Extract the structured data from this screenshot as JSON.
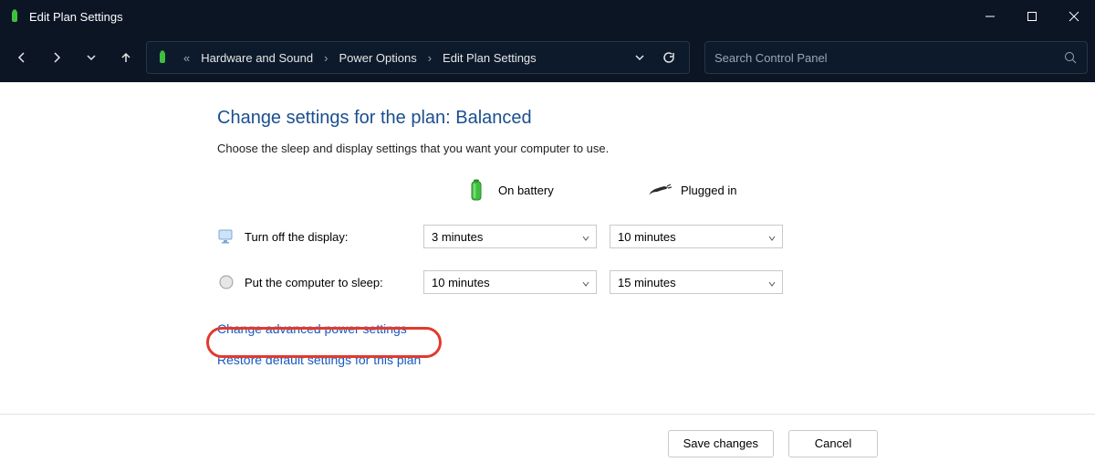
{
  "window": {
    "title": "Edit Plan Settings"
  },
  "breadcrumbs": {
    "item0": "Hardware and Sound",
    "item1": "Power Options",
    "item2": "Edit Plan Settings"
  },
  "search": {
    "placeholder": "Search Control Panel"
  },
  "page": {
    "title": "Change settings for the plan: Balanced",
    "subtitle": "Choose the sleep and display settings that you want your computer to use."
  },
  "columns": {
    "battery": "On battery",
    "plugged": "Plugged in"
  },
  "rows": {
    "display": {
      "label": "Turn off the display:",
      "battery": "3 minutes",
      "plugged": "10 minutes"
    },
    "sleep": {
      "label": "Put the computer to sleep:",
      "battery": "10 minutes",
      "plugged": "15 minutes"
    }
  },
  "links": {
    "advanced": "Change advanced power settings",
    "restore": "Restore default settings for this plan"
  },
  "buttons": {
    "save": "Save changes",
    "cancel": "Cancel"
  }
}
